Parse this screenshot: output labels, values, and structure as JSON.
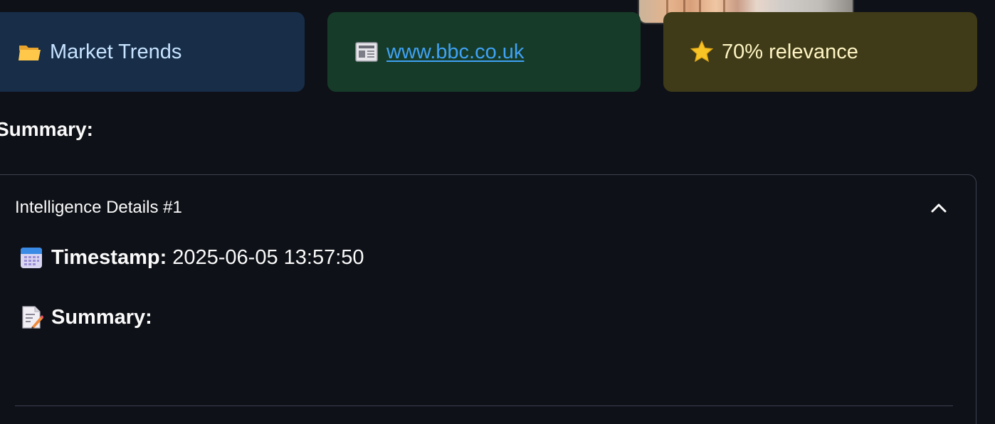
{
  "chips": {
    "category": {
      "icon": "folder-icon",
      "label": "Market Trends"
    },
    "source": {
      "icon": "newspaper-icon",
      "link_text": "www.bbc.co.uk"
    },
    "relevance": {
      "icon": "star-icon",
      "label": "70% relevance"
    }
  },
  "section": {
    "heading": "Summary:"
  },
  "expander": {
    "title": "Intelligence Details #1",
    "toggle_icon": "chevron-up-icon",
    "timestamp_icon": "calendar-icon",
    "timestamp_label": "Timestamp:",
    "timestamp_value": "2025-06-05 13:57:50",
    "summary_icon": "memo-icon",
    "summary_label": "Summary:"
  },
  "colors": {
    "background": "#0e1117",
    "category_chip": "#172d48",
    "source_chip": "#173b29",
    "relevance_chip": "#3f3b18",
    "link": "#3fa2f4"
  }
}
